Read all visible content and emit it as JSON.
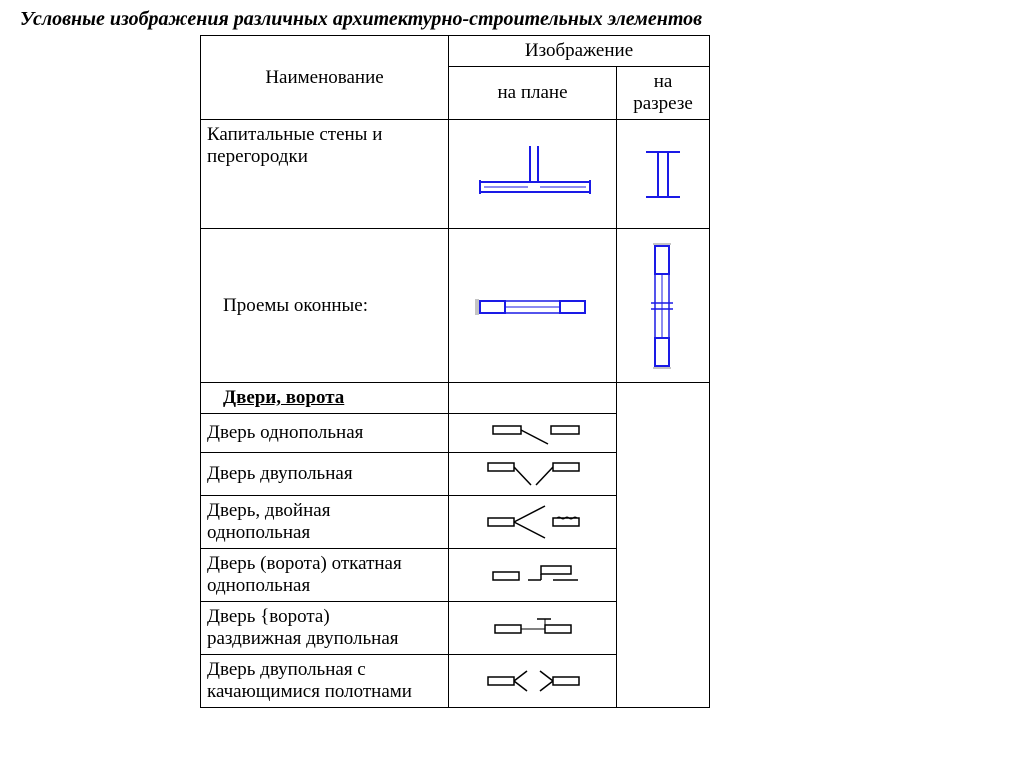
{
  "title": "Условные изображения различных архитектурно-строительных элементов",
  "header": {
    "name": "Наименование",
    "image": "Изображение",
    "plan": "на плане",
    "section": "на разрезе"
  },
  "rows": {
    "walls": "Капитальные стены и перегородки",
    "windows": "Проемы оконные:",
    "doors_heading": "Двери, ворота",
    "d1": "Дверь однопольная",
    "d2": "Дверь двупольная",
    "d3a": "Дверь, двойная",
    "d3b": "однопольная",
    "d4a": "Дверь (ворота) откатная",
    "d4b": "однопольная",
    "d5a": "Дверь {ворота)",
    "d5b": "раздвижная двупольная",
    "d6a": "Дверь двупольная с",
    "d6b": "качающимися полотнами"
  }
}
